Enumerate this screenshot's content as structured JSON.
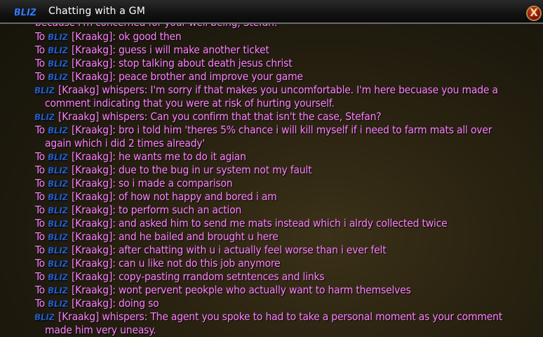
{
  "window": {
    "title": "Chatting with a GM",
    "close_label": "X",
    "logo_text": "BLIZ"
  },
  "cut_line": "because i'm concerned for your well being, Stefan.",
  "messages": [
    {
      "type": "to",
      "prefix": "To",
      "name": "[Kraakg]:",
      "text": "ok good then"
    },
    {
      "type": "to",
      "prefix": "To",
      "name": "[Kraakg]:",
      "text": "guess i will make another ticket"
    },
    {
      "type": "to",
      "prefix": "To",
      "name": "[Kraakg]:",
      "text": "stop talking about death jesus christ"
    },
    {
      "type": "to",
      "prefix": "To",
      "name": "[Kraakg]:",
      "text": "peace brother and improve your game"
    },
    {
      "type": "whisper",
      "name": "[Kraakg] whispers:",
      "text": "I'm sorry if that makes you uncomfortable. I'm here becuase you made a",
      "cont": "comment indicating that you were at risk of hurting yourself."
    },
    {
      "type": "whisper",
      "name": "[Kraakg] whispers:",
      "text": "Can you confirm that that isn't the case, Stefan?"
    },
    {
      "type": "to",
      "prefix": "To",
      "name": "[Kraakg]:",
      "text": "bro i told him 'theres 5% chance i will kill myself if i need to farm mats all over",
      "cont": "again which i did 2 times already'"
    },
    {
      "type": "to",
      "prefix": "To",
      "name": "[Kraakg]:",
      "text": "he wants me to do it agian"
    },
    {
      "type": "to",
      "prefix": "To",
      "name": "[Kraakg]:",
      "text": "due to the bug in ur system not my fault"
    },
    {
      "type": "to",
      "prefix": "To",
      "name": "[Kraakg]:",
      "text": "so i made a comparison"
    },
    {
      "type": "to",
      "prefix": "To",
      "name": "[Kraakg]:",
      "text": "of how not happy and bored i am"
    },
    {
      "type": "to",
      "prefix": "To",
      "name": "[Kraakg]:",
      "text": "to perform such an action"
    },
    {
      "type": "to",
      "prefix": "To",
      "name": "[Kraakg]:",
      "text": "and asked him to send me mats instead which i alrdy collected twice"
    },
    {
      "type": "to",
      "prefix": "To",
      "name": "[Kraakg]:",
      "text": "and he bailed and brought u here"
    },
    {
      "type": "to",
      "prefix": "To",
      "name": "[Kraakg]:",
      "text": "after chatting with u i actually feel worse than i ever felt"
    },
    {
      "type": "to",
      "prefix": "To",
      "name": "[Kraakg]:",
      "text": "can u like not do this job anymore"
    },
    {
      "type": "to",
      "prefix": "To",
      "name": "[Kraakg]:",
      "text": "copy-pasting rrandom setntences and links"
    },
    {
      "type": "to",
      "prefix": "To",
      "name": "[Kraakg]:",
      "text": "wont pervent peokple who actually want to harm themselves"
    },
    {
      "type": "to",
      "prefix": "To",
      "name": "[Kraakg]:",
      "text": "doing so"
    },
    {
      "type": "whisper",
      "name": "[Kraakg] whispers:",
      "text": "The agent you spoke to had to take a personal moment as your comment",
      "cont": "made him very uneasy."
    }
  ]
}
